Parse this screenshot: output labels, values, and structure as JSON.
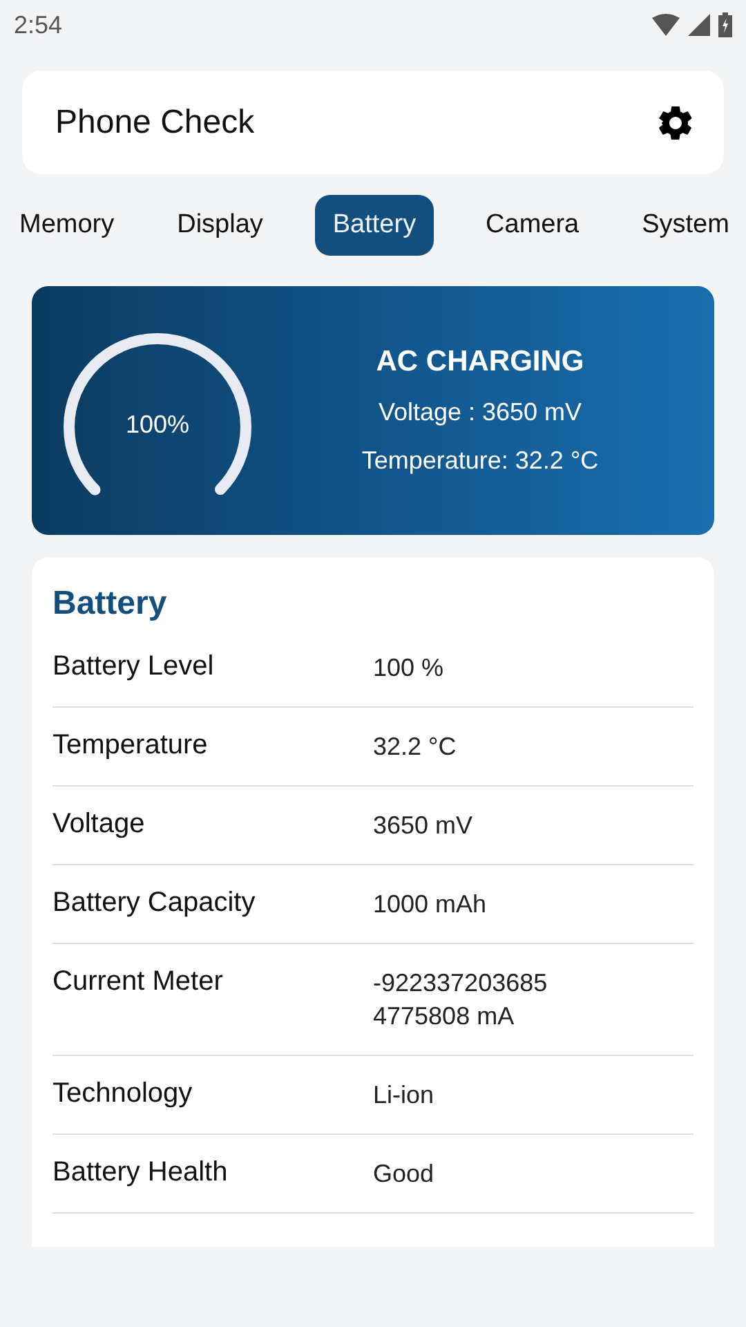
{
  "status_bar": {
    "time": "2:54"
  },
  "header": {
    "title": "Phone Check"
  },
  "tabs": [
    {
      "label": "Memory",
      "selected": false
    },
    {
      "label": "Display",
      "selected": false
    },
    {
      "label": "Battery",
      "selected": true
    },
    {
      "label": "Camera",
      "selected": false
    },
    {
      "label": "System",
      "selected": false
    }
  ],
  "summary": {
    "gauge": {
      "level": 1,
      "reading": "100%"
    },
    "status": "AC CHARGING",
    "voltage": "Voltage : 3650 mV",
    "temperature": "Temperature: 32.2 °C"
  },
  "details": {
    "title": "Battery",
    "rows": [
      {
        "label": "Battery Level",
        "value": "100 %"
      },
      {
        "label": "Temperature",
        "value": "32.2 °C"
      },
      {
        "label": "Voltage",
        "value": "3650 mV"
      },
      {
        "label": "Battery Capacity",
        "value": "1000 mAh"
      },
      {
        "label": "Current Meter",
        "value": "-9223372036854775808 mA"
      },
      {
        "label": "Technology",
        "value": "Li-ion"
      },
      {
        "label": "Battery Health",
        "value": "Good"
      }
    ]
  }
}
